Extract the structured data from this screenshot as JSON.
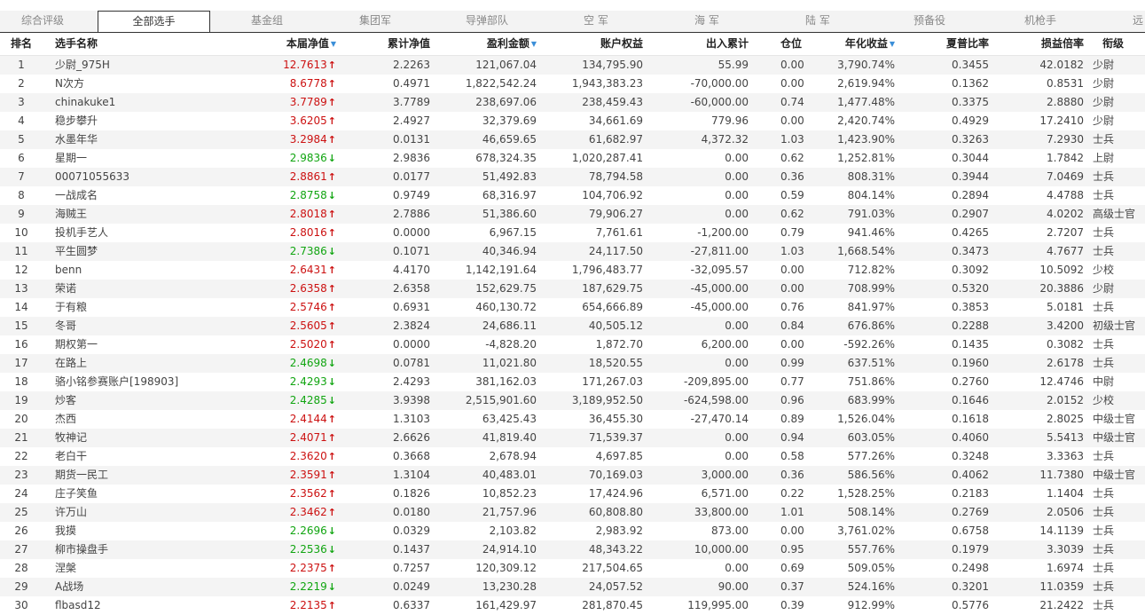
{
  "tabs": [
    "综合评级",
    "全部选手",
    "基金组",
    "集团军",
    "导弹部队",
    "空 军",
    "海 军",
    "陆 军",
    "预备役",
    "机枪手",
    "远"
  ],
  "active_tab": 1,
  "headers": {
    "rank": "排名",
    "name": "选手名称",
    "nav": "本届净值",
    "cum_nav": "累计净值",
    "profit": "盈利金额",
    "equity": "账户权益",
    "inout": "出入累计",
    "position": "仓位",
    "annual": "年化收益",
    "sharpe": "夏普比率",
    "pl_ratio": "损益倍率",
    "title": "衔级"
  },
  "rows": [
    {
      "rank": "1",
      "name": "少尉_975H",
      "nav": "12.7613",
      "dir": "up",
      "cum": "2.2263",
      "profit": "121,067.04",
      "equity": "134,795.90",
      "inout": "55.99",
      "pos": "0.00",
      "annual": "3,790.74%",
      "sharpe": "0.3455",
      "pl": "42.0182",
      "title": "少尉"
    },
    {
      "rank": "2",
      "name": "N次方",
      "nav": "8.6778",
      "dir": "up",
      "cum": "0.4971",
      "profit": "1,822,542.24",
      "equity": "1,943,383.23",
      "inout": "-70,000.00",
      "pos": "0.00",
      "annual": "2,619.94%",
      "sharpe": "0.1362",
      "pl": "0.8531",
      "title": "少尉"
    },
    {
      "rank": "3",
      "name": "chinakuke1",
      "nav": "3.7789",
      "dir": "up",
      "cum": "3.7789",
      "profit": "238,697.06",
      "equity": "238,459.43",
      "inout": "-60,000.00",
      "pos": "0.74",
      "annual": "1,477.48%",
      "sharpe": "0.3375",
      "pl": "2.8880",
      "title": "少尉"
    },
    {
      "rank": "4",
      "name": "稳步攀升",
      "nav": "3.6205",
      "dir": "up",
      "cum": "2.4927",
      "profit": "32,379.69",
      "equity": "34,661.69",
      "inout": "779.96",
      "pos": "0.00",
      "annual": "2,420.74%",
      "sharpe": "0.4929",
      "pl": "17.2410",
      "title": "少尉"
    },
    {
      "rank": "5",
      "name": "水墨年华",
      "nav": "3.2984",
      "dir": "up",
      "cum": "0.0131",
      "profit": "46,659.65",
      "equity": "61,682.97",
      "inout": "4,372.32",
      "pos": "1.03",
      "annual": "1,423.90%",
      "sharpe": "0.3263",
      "pl": "7.2930",
      "title": "士兵"
    },
    {
      "rank": "6",
      "name": "星期一",
      "nav": "2.9836",
      "dir": "down",
      "cum": "2.9836",
      "profit": "678,324.35",
      "equity": "1,020,287.41",
      "inout": "0.00",
      "pos": "0.62",
      "annual": "1,252.81%",
      "sharpe": "0.3044",
      "pl": "1.7842",
      "title": "上尉"
    },
    {
      "rank": "7",
      "name": "00071055633",
      "nav": "2.8861",
      "dir": "up",
      "cum": "0.0177",
      "profit": "51,492.83",
      "equity": "78,794.58",
      "inout": "0.00",
      "pos": "0.36",
      "annual": "808.31%",
      "sharpe": "0.3944",
      "pl": "7.0469",
      "title": "士兵"
    },
    {
      "rank": "8",
      "name": "一战成名",
      "nav": "2.8758",
      "dir": "down",
      "cum": "0.9749",
      "profit": "68,316.97",
      "equity": "104,706.92",
      "inout": "0.00",
      "pos": "0.59",
      "annual": "804.14%",
      "sharpe": "0.2894",
      "pl": "4.4788",
      "title": "士兵"
    },
    {
      "rank": "9",
      "name": "海贼王",
      "nav": "2.8018",
      "dir": "up",
      "cum": "2.7886",
      "profit": "51,386.60",
      "equity": "79,906.27",
      "inout": "0.00",
      "pos": "0.62",
      "annual": "791.03%",
      "sharpe": "0.2907",
      "pl": "4.0202",
      "title": "高级士官"
    },
    {
      "rank": "10",
      "name": "投机手艺人",
      "nav": "2.8016",
      "dir": "up",
      "cum": "0.0000",
      "profit": "6,967.15",
      "equity": "7,761.61",
      "inout": "-1,200.00",
      "pos": "0.79",
      "annual": "941.46%",
      "sharpe": "0.4265",
      "pl": "2.7207",
      "title": "士兵"
    },
    {
      "rank": "11",
      "name": "平生圆梦",
      "nav": "2.7386",
      "dir": "down",
      "cum": "0.1071",
      "profit": "40,346.94",
      "equity": "24,117.50",
      "inout": "-27,811.00",
      "pos": "1.03",
      "annual": "1,668.54%",
      "sharpe": "0.3473",
      "pl": "4.7677",
      "title": "士兵"
    },
    {
      "rank": "12",
      "name": "benn",
      "nav": "2.6431",
      "dir": "up",
      "cum": "4.4170",
      "profit": "1,142,191.64",
      "equity": "1,796,483.77",
      "inout": "-32,095.57",
      "pos": "0.00",
      "annual": "712.82%",
      "sharpe": "0.3092",
      "pl": "10.5092",
      "title": "少校"
    },
    {
      "rank": "13",
      "name": "荣诺",
      "nav": "2.6358",
      "dir": "up",
      "cum": "2.6358",
      "profit": "152,629.75",
      "equity": "187,629.75",
      "inout": "-45,000.00",
      "pos": "0.00",
      "annual": "708.99%",
      "sharpe": "0.5320",
      "pl": "20.3886",
      "title": "少尉"
    },
    {
      "rank": "14",
      "name": "于有粮",
      "nav": "2.5746",
      "dir": "up",
      "cum": "0.6931",
      "profit": "460,130.72",
      "equity": "654,666.89",
      "inout": "-45,000.00",
      "pos": "0.76",
      "annual": "841.97%",
      "sharpe": "0.3853",
      "pl": "5.0181",
      "title": "士兵"
    },
    {
      "rank": "15",
      "name": "冬哥",
      "nav": "2.5605",
      "dir": "up",
      "cum": "2.3824",
      "profit": "24,686.11",
      "equity": "40,505.12",
      "inout": "0.00",
      "pos": "0.84",
      "annual": "676.86%",
      "sharpe": "0.2288",
      "pl": "3.4200",
      "title": "初级士官"
    },
    {
      "rank": "16",
      "name": "期权第一",
      "nav": "2.5020",
      "dir": "up",
      "cum": "0.0000",
      "profit": "-4,828.20",
      "equity": "1,872.70",
      "inout": "6,200.00",
      "pos": "0.00",
      "annual": "-592.26%",
      "sharpe": "0.1435",
      "pl": "0.3082",
      "title": "士兵"
    },
    {
      "rank": "17",
      "name": "在路上",
      "nav": "2.4698",
      "dir": "down",
      "cum": "0.0781",
      "profit": "11,021.80",
      "equity": "18,520.55",
      "inout": "0.00",
      "pos": "0.99",
      "annual": "637.51%",
      "sharpe": "0.1960",
      "pl": "2.6178",
      "title": "士兵"
    },
    {
      "rank": "18",
      "name": "骆小铭参赛账户[198903]",
      "nav": "2.4293",
      "dir": "down",
      "cum": "2.4293",
      "profit": "381,162.03",
      "equity": "171,267.03",
      "inout": "-209,895.00",
      "pos": "0.77",
      "annual": "751.86%",
      "sharpe": "0.2760",
      "pl": "12.4746",
      "title": "中尉"
    },
    {
      "rank": "19",
      "name": "炒客",
      "nav": "2.4285",
      "dir": "down",
      "cum": "3.9398",
      "profit": "2,515,901.60",
      "equity": "3,189,952.50",
      "inout": "-624,598.00",
      "pos": "0.96",
      "annual": "683.99%",
      "sharpe": "0.1646",
      "pl": "2.0152",
      "title": "少校"
    },
    {
      "rank": "20",
      "name": "杰西",
      "nav": "2.4144",
      "dir": "up",
      "cum": "1.3103",
      "profit": "63,425.43",
      "equity": "36,455.30",
      "inout": "-27,470.14",
      "pos": "0.89",
      "annual": "1,526.04%",
      "sharpe": "0.1618",
      "pl": "2.8025",
      "title": "中级士官"
    },
    {
      "rank": "21",
      "name": "牧神记",
      "nav": "2.4071",
      "dir": "up",
      "cum": "2.6626",
      "profit": "41,819.40",
      "equity": "71,539.37",
      "inout": "0.00",
      "pos": "0.94",
      "annual": "603.05%",
      "sharpe": "0.4060",
      "pl": "5.5413",
      "title": "中级士官"
    },
    {
      "rank": "22",
      "name": "老白干",
      "nav": "2.3620",
      "dir": "up",
      "cum": "0.3668",
      "profit": "2,678.94",
      "equity": "4,697.85",
      "inout": "0.00",
      "pos": "0.58",
      "annual": "577.26%",
      "sharpe": "0.3248",
      "pl": "3.3363",
      "title": "士兵"
    },
    {
      "rank": "23",
      "name": "期货一民工",
      "nav": "2.3591",
      "dir": "up",
      "cum": "1.3104",
      "profit": "40,483.01",
      "equity": "70,169.03",
      "inout": "3,000.00",
      "pos": "0.36",
      "annual": "586.56%",
      "sharpe": "0.4062",
      "pl": "11.7380",
      "title": "中级士官"
    },
    {
      "rank": "24",
      "name": "庄子笑鱼",
      "nav": "2.3562",
      "dir": "up",
      "cum": "0.1826",
      "profit": "10,852.23",
      "equity": "17,424.96",
      "inout": "6,571.00",
      "pos": "0.22",
      "annual": "1,528.25%",
      "sharpe": "0.2183",
      "pl": "1.1404",
      "title": "士兵"
    },
    {
      "rank": "25",
      "name": "许万山",
      "nav": "2.3462",
      "dir": "up",
      "cum": "0.0180",
      "profit": "21,757.96",
      "equity": "60,808.80",
      "inout": "33,800.00",
      "pos": "1.01",
      "annual": "508.14%",
      "sharpe": "0.2769",
      "pl": "2.0506",
      "title": "士兵"
    },
    {
      "rank": "26",
      "name": "我摸",
      "nav": "2.2696",
      "dir": "down",
      "cum": "0.0329",
      "profit": "2,103.82",
      "equity": "2,983.92",
      "inout": "873.00",
      "pos": "0.00",
      "annual": "3,761.02%",
      "sharpe": "0.6758",
      "pl": "14.1139",
      "title": "士兵"
    },
    {
      "rank": "27",
      "name": "柳市操盘手",
      "nav": "2.2536",
      "dir": "down",
      "cum": "0.1437",
      "profit": "24,914.10",
      "equity": "48,343.22",
      "inout": "10,000.00",
      "pos": "0.95",
      "annual": "557.76%",
      "sharpe": "0.1979",
      "pl": "3.3039",
      "title": "士兵"
    },
    {
      "rank": "28",
      "name": "涅槃",
      "nav": "2.2375",
      "dir": "up",
      "cum": "0.7257",
      "profit": "120,309.12",
      "equity": "217,504.65",
      "inout": "0.00",
      "pos": "0.69",
      "annual": "509.05%",
      "sharpe": "0.2498",
      "pl": "1.6974",
      "title": "士兵"
    },
    {
      "rank": "29",
      "name": "A战场",
      "nav": "2.2219",
      "dir": "down",
      "cum": "0.0249",
      "profit": "13,230.28",
      "equity": "24,057.52",
      "inout": "90.00",
      "pos": "0.37",
      "annual": "524.16%",
      "sharpe": "0.3201",
      "pl": "11.0359",
      "title": "士兵"
    },
    {
      "rank": "30",
      "name": "flbasd12",
      "nav": "2.2135",
      "dir": "up",
      "cum": "0.6337",
      "profit": "161,429.97",
      "equity": "281,870.45",
      "inout": "119,995.00",
      "pos": "0.39",
      "annual": "912.99%",
      "sharpe": "0.5776",
      "pl": "21.2422",
      "title": "士兵"
    }
  ],
  "colors": {
    "up": "#cc1111",
    "down": "#11a511",
    "sort_icon": "#3a8ed8",
    "stripe": "#f4f4f4"
  },
  "icons": {
    "up": "arrow-up-icon",
    "down": "arrow-down-icon",
    "sort": "sort-desc-icon"
  }
}
